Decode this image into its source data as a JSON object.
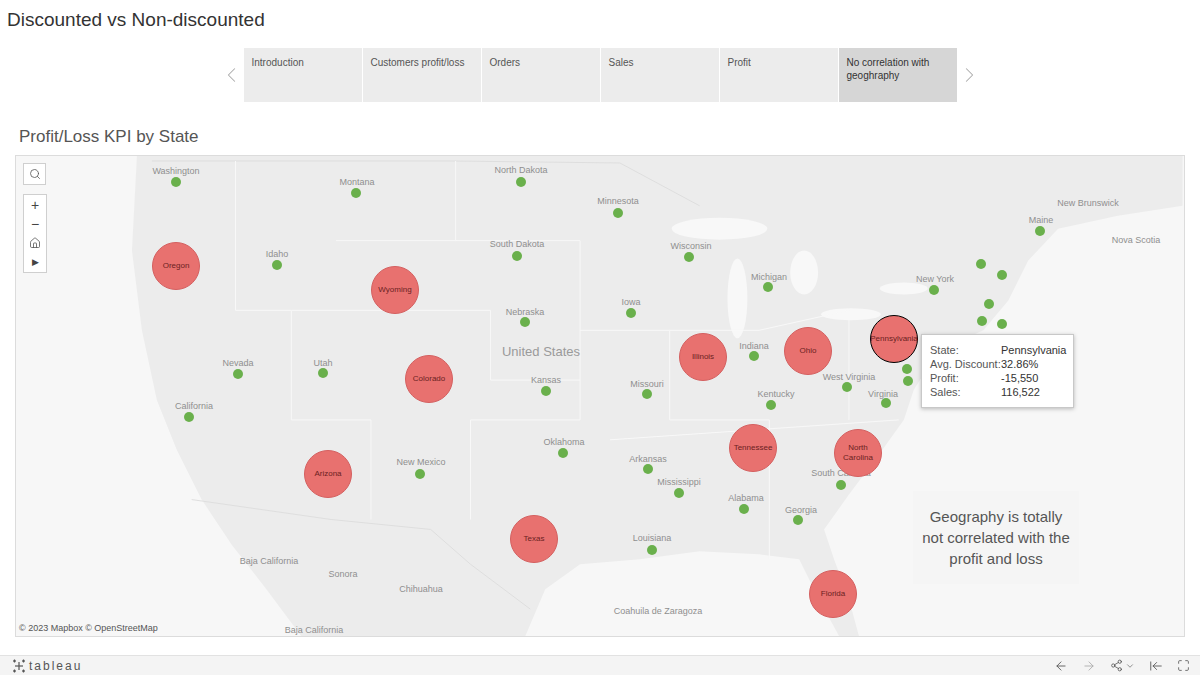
{
  "title": "Discounted vs Non-discounted",
  "story_points": [
    {
      "label": "Introduction",
      "selected": false
    },
    {
      "label": "Customers profit/loss",
      "selected": false
    },
    {
      "label": "Orders",
      "selected": false
    },
    {
      "label": "Sales",
      "selected": false
    },
    {
      "label": "Profit",
      "selected": false
    },
    {
      "label": "No correlation with geoghraphy",
      "selected": true
    }
  ],
  "sheet_title": "Profit/Loss KPI by State",
  "map_controls": {
    "zoom_in": "+",
    "zoom_out": "−",
    "expand": "▶"
  },
  "map_labels": [
    {
      "text": "Washington",
      "kind": "state"
    },
    {
      "text": "Montana",
      "kind": "state"
    },
    {
      "text": "North Dakota",
      "kind": "state"
    },
    {
      "text": "Minnesota",
      "kind": "state"
    },
    {
      "text": "New Brunswick",
      "kind": "state"
    },
    {
      "text": "Nova Scotia",
      "kind": "state"
    },
    {
      "text": "Maine",
      "kind": "state"
    },
    {
      "text": "Idaho",
      "kind": "state"
    },
    {
      "text": "South Dakota",
      "kind": "state"
    },
    {
      "text": "Wisconsin",
      "kind": "state"
    },
    {
      "text": "Michigan",
      "kind": "state"
    },
    {
      "text": "New York",
      "kind": "state"
    },
    {
      "text": "Nebraska",
      "kind": "state"
    },
    {
      "text": "United States",
      "kind": "country"
    },
    {
      "text": "Iowa",
      "kind": "state"
    },
    {
      "text": "Indiana",
      "kind": "state"
    },
    {
      "text": "Nevada",
      "kind": "state"
    },
    {
      "text": "Utah",
      "kind": "state"
    },
    {
      "text": "Kansas",
      "kind": "state"
    },
    {
      "text": "Missouri",
      "kind": "state"
    },
    {
      "text": "Kentucky",
      "kind": "state"
    },
    {
      "text": "West Virginia",
      "kind": "state"
    },
    {
      "text": "Virginia",
      "kind": "state"
    },
    {
      "text": "California",
      "kind": "state"
    },
    {
      "text": "Oklahoma",
      "kind": "state"
    },
    {
      "text": "New Mexico",
      "kind": "state"
    },
    {
      "text": "Arkansas",
      "kind": "state"
    },
    {
      "text": "Mississippi",
      "kind": "state"
    },
    {
      "text": "South Carolina",
      "kind": "state"
    },
    {
      "text": "Alabama",
      "kind": "state"
    },
    {
      "text": "Georgia",
      "kind": "state"
    },
    {
      "text": "Louisiana",
      "kind": "state"
    },
    {
      "text": "Baja California",
      "kind": "state"
    },
    {
      "text": "Sonora",
      "kind": "state"
    },
    {
      "text": "Chihuahua",
      "kind": "state"
    },
    {
      "text": "Coahuila de Zaragoza",
      "kind": "state"
    },
    {
      "text": "Baja California",
      "kind": "state"
    }
  ],
  "markers": [
    {
      "kind": "profit",
      "color": "#6ab04c",
      "selected": false
    },
    {
      "kind": "profit",
      "color": "#6ab04c",
      "selected": false
    },
    {
      "kind": "profit",
      "color": "#6ab04c",
      "selected": false
    },
    {
      "kind": "profit",
      "color": "#6ab04c",
      "selected": false
    },
    {
      "kind": "profit",
      "color": "#6ab04c",
      "selected": false
    },
    {
      "kind": "profit",
      "color": "#6ab04c",
      "selected": false
    },
    {
      "kind": "profit",
      "color": "#6ab04c",
      "selected": false
    },
    {
      "kind": "profit",
      "color": "#6ab04c",
      "selected": false
    },
    {
      "kind": "profit",
      "color": "#6ab04c",
      "selected": false
    },
    {
      "kind": "profit",
      "color": "#6ab04c",
      "selected": false
    },
    {
      "kind": "profit",
      "color": "#6ab04c",
      "selected": false
    },
    {
      "kind": "profit",
      "color": "#6ab04c",
      "selected": false
    },
    {
      "kind": "profit",
      "color": "#6ab04c",
      "selected": false
    },
    {
      "kind": "profit",
      "color": "#6ab04c",
      "selected": false
    },
    {
      "kind": "profit",
      "color": "#6ab04c",
      "selected": false
    },
    {
      "kind": "profit",
      "color": "#6ab04c",
      "selected": false
    },
    {
      "kind": "profit",
      "color": "#6ab04c",
      "selected": false
    },
    {
      "kind": "profit",
      "color": "#6ab04c",
      "selected": false
    },
    {
      "kind": "profit",
      "color": "#6ab04c",
      "selected": false
    },
    {
      "kind": "profit",
      "color": "#6ab04c",
      "selected": false
    },
    {
      "kind": "profit",
      "color": "#6ab04c",
      "selected": false
    },
    {
      "kind": "profit",
      "color": "#6ab04c",
      "selected": false
    },
    {
      "kind": "profit",
      "color": "#6ab04c",
      "selected": false
    },
    {
      "kind": "profit",
      "color": "#6ab04c",
      "selected": false
    },
    {
      "kind": "profit",
      "color": "#6ab04c",
      "selected": false
    },
    {
      "kind": "profit",
      "color": "#6ab04c",
      "selected": false
    },
    {
      "kind": "profit",
      "color": "#6ab04c",
      "selected": false
    },
    {
      "kind": "profit",
      "color": "#6ab04c",
      "selected": false
    },
    {
      "kind": "profit",
      "color": "#6ab04c",
      "selected": false
    },
    {
      "kind": "profit",
      "color": "#6ab04c",
      "selected": false
    },
    {
      "kind": "profit",
      "color": "#6ab04c",
      "selected": false
    },
    {
      "kind": "profit",
      "color": "#6ab04c",
      "selected": false
    },
    {
      "kind": "profit",
      "color": "#6ab04c",
      "selected": false
    },
    {
      "kind": "profit",
      "color": "#6ab04c",
      "selected": false
    },
    {
      "kind": "profit",
      "color": "#6ab04c",
      "selected": false
    },
    {
      "kind": "profit",
      "color": "#6ab04c",
      "selected": false
    },
    {
      "kind": "loss",
      "label": "Oregon",
      "color": "#e8716f",
      "selected": false
    },
    {
      "kind": "loss",
      "label": "Wyoming",
      "color": "#e8716f",
      "selected": false
    },
    {
      "kind": "loss",
      "label": "Colorado",
      "color": "#e8716f",
      "selected": false
    },
    {
      "kind": "loss",
      "label": "Arizona",
      "color": "#e8716f",
      "selected": false
    },
    {
      "kind": "loss",
      "label": "Texas",
      "color": "#e8716f",
      "selected": false
    },
    {
      "kind": "loss",
      "label": "Illinois",
      "color": "#e8716f",
      "selected": false
    },
    {
      "kind": "loss",
      "label": "Ohio",
      "color": "#e8716f",
      "selected": false
    },
    {
      "kind": "loss",
      "label": "Tennessee",
      "color": "#e8716f",
      "selected": false
    },
    {
      "kind": "loss",
      "label": "North Carolina",
      "color": "#e8716f",
      "selected": false
    },
    {
      "kind": "loss",
      "label": "Florida",
      "color": "#e8716f",
      "selected": false
    },
    {
      "kind": "loss",
      "label": "Pennsylvania",
      "color": "#e8716f",
      "selected": true
    }
  ],
  "tooltip": {
    "rows": [
      {
        "key": "State:",
        "value": "Pennsylvania"
      },
      {
        "key": "Avg. Discount:",
        "value": "32.86%"
      },
      {
        "key": "Profit:",
        "value": "-15,550"
      },
      {
        "key": "Sales:",
        "value": "116,522"
      }
    ]
  },
  "annotation": "Geography is totally not correlated with the profit and loss",
  "attribution": "© 2023 Mapbox © OpenStreetMap",
  "footer": {
    "logo": "tableau"
  }
}
